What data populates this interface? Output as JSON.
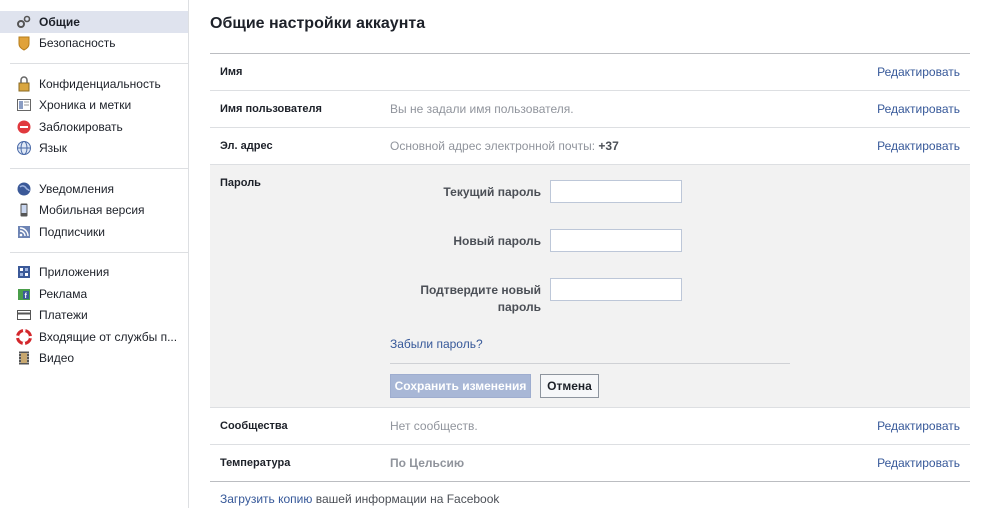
{
  "sidebar": {
    "groups": [
      [
        {
          "label": "Общие",
          "icon": "gears-icon",
          "active": true
        },
        {
          "label": "Безопасность",
          "icon": "shield-icon"
        }
      ],
      [
        {
          "label": "Конфиденциальность",
          "icon": "lock-icon"
        },
        {
          "label": "Хроника и метки",
          "icon": "timeline-icon"
        },
        {
          "label": "Заблокировать",
          "icon": "block-icon"
        },
        {
          "label": "Язык",
          "icon": "globe-icon"
        }
      ],
      [
        {
          "label": "Уведомления",
          "icon": "globe-notification-icon"
        },
        {
          "label": "Мобильная версия",
          "icon": "mobile-icon"
        },
        {
          "label": "Подписчики",
          "icon": "rss-icon"
        }
      ],
      [
        {
          "label": "Приложения",
          "icon": "apps-icon"
        },
        {
          "label": "Реклама",
          "icon": "ads-icon"
        },
        {
          "label": "Платежи",
          "icon": "payments-icon"
        },
        {
          "label": "Входящие от службы п...",
          "icon": "lifebuoy-icon"
        },
        {
          "label": "Видео",
          "icon": "film-icon"
        }
      ]
    ]
  },
  "main": {
    "title": "Общие настройки аккаунта",
    "edit_label": "Редактировать",
    "rows_top": [
      {
        "label": "Имя",
        "value": ""
      },
      {
        "label": "Имя пользователя",
        "value": "Вы не задали имя пользователя."
      },
      {
        "label": "Эл. адрес",
        "value": "Основной адрес электронной почты: ",
        "value_bold": "+37"
      }
    ],
    "password": {
      "label": "Пароль",
      "current_label": "Текущий пароль",
      "new_label": "Новый пароль",
      "confirm_label": "Подтвердите новый пароль",
      "forgot": "Забыли пароль?",
      "save": "Сохранить изменения",
      "cancel": "Отмена"
    },
    "rows_bottom": [
      {
        "label": "Сообщества",
        "value": "Нет сообществ."
      },
      {
        "label": "Температура",
        "value": "По Цельсию"
      }
    ],
    "footer": {
      "link": "Загрузить копию",
      "text": " вашей информации на Facebook"
    }
  }
}
